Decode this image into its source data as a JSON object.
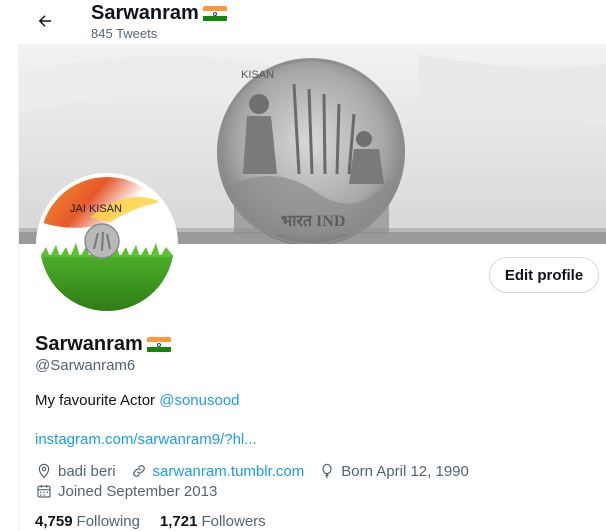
{
  "header": {
    "title": "Sarwanram",
    "tweet_count": "845 Tweets"
  },
  "flag_colors": {
    "saffron": "#ff9933",
    "white": "#ffffff",
    "green": "#138808",
    "chakra": "#1e3a8a"
  },
  "banner": {
    "coin_text_top": "KISAN",
    "coin_text_bottom": "भारत IND"
  },
  "avatar": {
    "caption": "JAI KISAN"
  },
  "profile": {
    "edit_button": "Edit profile",
    "name": "Sarwanram",
    "handle": "@Sarwanram6",
    "bio_text": "My favourite Actor ",
    "bio_mention": "@sonusood",
    "link": "instagram.com/sarwanram9/?hl...",
    "location": "badi beri",
    "website": "sarwanram.tumblr.com",
    "birthday": "Born April 12, 1990",
    "joined": "Joined September 2013",
    "following_count": "4,759",
    "following_label": "Following",
    "followers_count": "1,721",
    "followers_label": "Followers"
  },
  "colors": {
    "accent": "#1d9bf0",
    "text": "#0f1419",
    "muted": "#536471"
  }
}
